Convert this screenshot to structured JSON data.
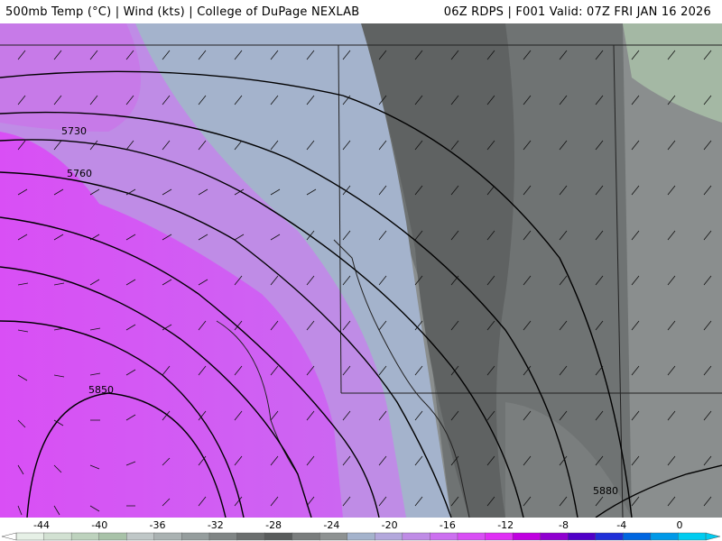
{
  "header": {
    "title_left": "500mb Temp (°C) | Wind (kts) | College of DuPage NEXLAB",
    "title_right": "06Z RDPS | F001 Valid: 07Z FRI JAN 16 2026"
  },
  "map": {
    "contours": [
      {
        "label": "5730"
      },
      {
        "label": "5760"
      },
      {
        "label": "5850"
      },
      {
        "label": "5880"
      }
    ]
  },
  "colorbar": {
    "tick_labels": [
      "-44",
      "-40",
      "-36",
      "-32",
      "-28",
      "-24",
      "-20",
      "-16",
      "-12",
      "-8",
      "-4",
      "0"
    ],
    "colors": [
      "#e6f0e6",
      "#d2e1d2",
      "#bdd2bd",
      "#a8c2a8",
      "#bfc7c7",
      "#aab2b2",
      "#959d9d",
      "#808585",
      "#6b6e6e",
      "#595c5c",
      "#7a7d7d",
      "#8e9292",
      "#a4b3cc",
      "#b3a8dc",
      "#bf8ce6",
      "#cc70f0",
      "#d94ff5",
      "#e030f5",
      "#c000e0",
      "#9000d0",
      "#5000c8",
      "#2030d8",
      "#0066e0",
      "#0099e8",
      "#00ccf0"
    ]
  }
}
